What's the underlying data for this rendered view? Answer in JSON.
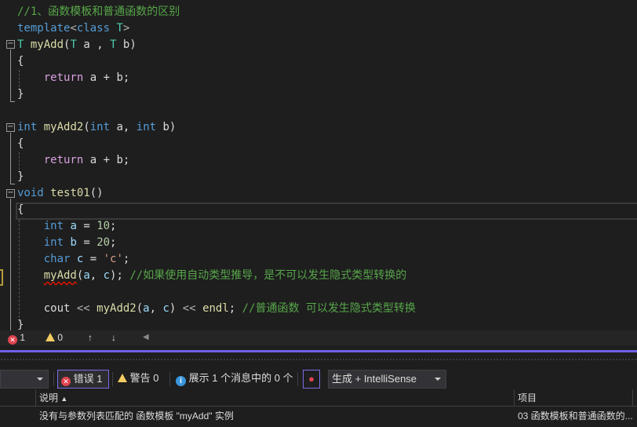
{
  "editor": {
    "lines": [
      [
        [
          "//1、函数模板和普通函数的区别",
          "c"
        ]
      ],
      [
        [
          "template",
          "k"
        ],
        [
          "<",
          "o"
        ],
        [
          "class",
          "k"
        ],
        [
          " ",
          "p"
        ],
        [
          "T",
          "t"
        ],
        [
          ">",
          "o"
        ]
      ],
      [
        [
          "T",
          "t"
        ],
        [
          " ",
          "p"
        ],
        [
          "myAdd",
          "f"
        ],
        [
          "(",
          "p"
        ],
        [
          "T",
          "t"
        ],
        [
          " a , ",
          "p"
        ],
        [
          "T",
          "t"
        ],
        [
          " b)",
          "p"
        ]
      ],
      [
        [
          "{",
          "p"
        ]
      ],
      [
        [
          "    ",
          "p"
        ],
        [
          "return",
          "r"
        ],
        [
          " a + b;",
          "p"
        ]
      ],
      [
        [
          "}",
          "p"
        ]
      ],
      [],
      [
        [
          "int",
          "k"
        ],
        [
          " ",
          "p"
        ],
        [
          "myAdd2",
          "f"
        ],
        [
          "(",
          "p"
        ],
        [
          "int",
          "k"
        ],
        [
          " a, ",
          "p"
        ],
        [
          "int",
          "k"
        ],
        [
          " b)",
          "p"
        ]
      ],
      [
        [
          "{",
          "p"
        ]
      ],
      [
        [
          "    ",
          "p"
        ],
        [
          "return",
          "r"
        ],
        [
          " a + b;",
          "p"
        ]
      ],
      [
        [
          "}",
          "p"
        ]
      ],
      [
        [
          "void",
          "k"
        ],
        [
          " ",
          "p"
        ],
        [
          "test01",
          "f"
        ],
        [
          "()",
          "p"
        ]
      ],
      [
        [
          "{",
          "p"
        ]
      ],
      [
        [
          "    ",
          "p"
        ],
        [
          "int",
          "k"
        ],
        [
          " ",
          "p"
        ],
        [
          "a",
          "v"
        ],
        [
          " = ",
          "p"
        ],
        [
          "10",
          "n"
        ],
        [
          ";",
          "p"
        ]
      ],
      [
        [
          "    ",
          "p"
        ],
        [
          "int",
          "k"
        ],
        [
          " ",
          "p"
        ],
        [
          "b",
          "v"
        ],
        [
          " = ",
          "p"
        ],
        [
          "20",
          "n"
        ],
        [
          ";",
          "p"
        ]
      ],
      [
        [
          "    ",
          "p"
        ],
        [
          "char",
          "k"
        ],
        [
          " ",
          "p"
        ],
        [
          "c",
          "v"
        ],
        [
          " = ",
          "p"
        ],
        [
          "'c'",
          "s"
        ],
        [
          ";",
          "p"
        ]
      ],
      [
        [
          "    ",
          "p"
        ],
        [
          "myAdd",
          "f err"
        ],
        [
          "(",
          "p"
        ],
        [
          "a",
          "v"
        ],
        [
          ", ",
          "p"
        ],
        [
          "c",
          "v"
        ],
        [
          "); ",
          "p"
        ],
        [
          "//如果使用自动类型推导，是不可以发生隐式类型转换的",
          "c"
        ]
      ],
      [],
      [
        [
          "    ",
          "p"
        ],
        [
          "cout",
          "p"
        ],
        [
          " << ",
          "o"
        ],
        [
          "myAdd2",
          "f"
        ],
        [
          "(",
          "p"
        ],
        [
          "a",
          "v"
        ],
        [
          ", ",
          "p"
        ],
        [
          "c",
          "v"
        ],
        [
          ") ",
          "p"
        ],
        [
          "<<",
          "o"
        ],
        [
          " ",
          "p"
        ],
        [
          "endl",
          "f"
        ],
        [
          "; ",
          "p"
        ],
        [
          "//普通函数 可以发生隐式类型转换",
          "c"
        ]
      ],
      [
        [
          "}",
          "p"
        ]
      ]
    ]
  },
  "status": {
    "errors": "1",
    "warnings": "0",
    "up_arrow": "↑",
    "down_arrow": "↓"
  },
  "error_list": {
    "errors_label": "错误 1",
    "warnings_label": "警告 0",
    "messages_label": "展示 1 个消息中的 0 个",
    "source_filter": "生成 + IntelliSense",
    "columns": {
      "description": "说明",
      "project": "项目"
    },
    "rows": [
      {
        "description": "没有与参数列表匹配的 函数模板 \"myAdd\" 实例",
        "project": "03 函数模板和普通函数的..."
      }
    ]
  },
  "colors": {
    "accent": "#7160e8",
    "error": "#e0434f",
    "warning": "#f2cc60",
    "info": "#3a96dd"
  }
}
